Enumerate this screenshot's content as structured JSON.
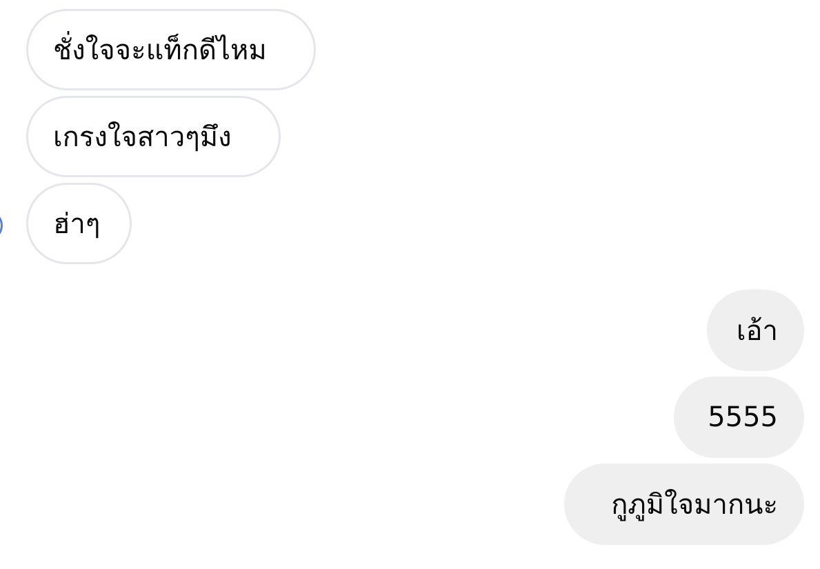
{
  "incoming_messages": [
    {
      "text": "ชั่งใจจะแท็กดีไหม"
    },
    {
      "text": "เกรงใจสาวๆมึง"
    },
    {
      "text": "ฮ่าๆ"
    }
  ],
  "outgoing_messages": [
    {
      "text": "เอ้า"
    },
    {
      "text": "5555"
    },
    {
      "text": "กูภูมิใจมากนะ"
    }
  ],
  "colors": {
    "incoming_border": "#e4e6eb",
    "outgoing_bg": "#efefef",
    "avatar_ring": "#5b7ec9"
  }
}
